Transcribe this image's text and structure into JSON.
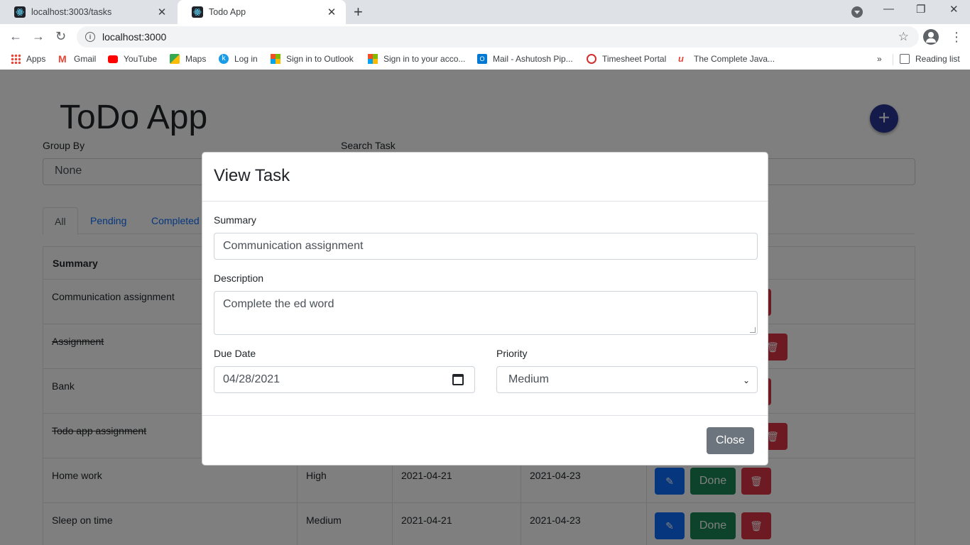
{
  "browser": {
    "tabs": [
      {
        "title": "localhost:3003/tasks",
        "active": false
      },
      {
        "title": "Todo App",
        "active": true
      }
    ],
    "url": "localhost:3000",
    "bookmarks": [
      {
        "label": "Apps",
        "icon": "apps-grid-icon"
      },
      {
        "label": "Gmail",
        "icon": "gmail-icon"
      },
      {
        "label": "YouTube",
        "icon": "youtube-icon"
      },
      {
        "label": "Maps",
        "icon": "maps-icon"
      },
      {
        "label": "Log in",
        "icon": "k-icon"
      },
      {
        "label": "Sign in to Outlook",
        "icon": "microsoft-icon"
      },
      {
        "label": "Sign in to your acco...",
        "icon": "microsoft-icon"
      },
      {
        "label": "Mail - Ashutosh Pip...",
        "icon": "outlook-icon"
      },
      {
        "label": "Timesheet Portal",
        "icon": "timesheet-icon"
      },
      {
        "label": "The Complete Java...",
        "icon": "udemy-icon"
      }
    ],
    "reading_list": "Reading list",
    "more_bookmarks": "»"
  },
  "app": {
    "title": "ToDo App",
    "group_by_label": "Group By",
    "group_by_value": "None",
    "search_label": "Search Task",
    "tabs": [
      "All",
      "Pending",
      "Completed"
    ],
    "table": {
      "header_summary": "Summary",
      "rows": [
        {
          "summary": "Communication assignment",
          "completed": false,
          "priority": "",
          "created": "",
          "due": ""
        },
        {
          "summary": "Assignment",
          "completed": true,
          "priority": "",
          "created": "",
          "due": ""
        },
        {
          "summary": "Bank",
          "completed": false,
          "priority": "",
          "created": "",
          "due": ""
        },
        {
          "summary": "Todo app assignment",
          "completed": true,
          "priority": "",
          "created": "",
          "due": ""
        },
        {
          "summary": "Home work",
          "completed": false,
          "priority": "High",
          "created": "2021-04-21",
          "due": "2021-04-23"
        },
        {
          "summary": "Sleep on time",
          "completed": false,
          "priority": "Medium",
          "created": "2021-04-21",
          "due": "2021-04-23"
        }
      ],
      "done_label": "Done"
    }
  },
  "modal": {
    "title": "View Task",
    "summary_label": "Summary",
    "summary_value": "Communication assignment",
    "description_label": "Description",
    "description_value": "Complete the ed word",
    "due_date_label": "Due Date",
    "due_date_value": "04/28/2021",
    "priority_label": "Priority",
    "priority_value": "Medium",
    "close_label": "Close"
  },
  "colors": {
    "primary": "#0d6efd",
    "success": "#198754",
    "danger": "#dc3545",
    "secondary": "#6c757d",
    "fab": "#283593"
  }
}
